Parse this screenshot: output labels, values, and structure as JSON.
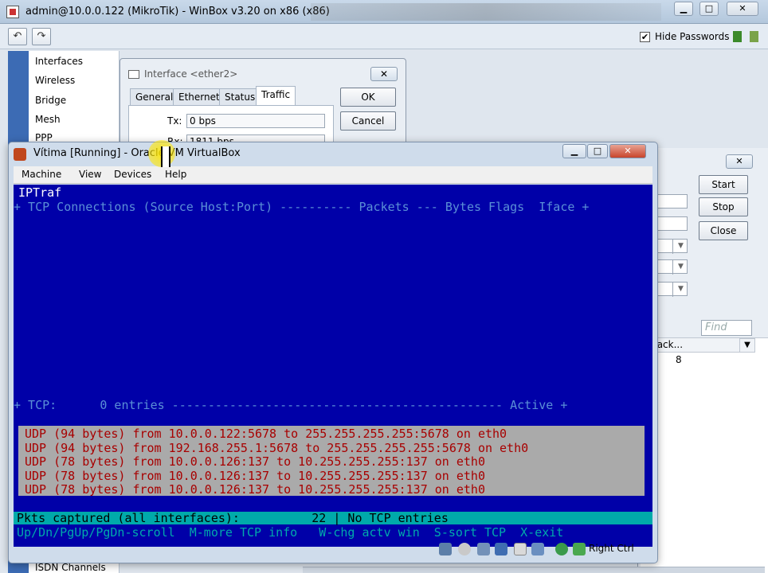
{
  "winbox": {
    "title": "admin@10.0.0.122 (MikroTik) - WinBox v3.20 on x86 (x86)",
    "hide_passwords_label": "Hide Passwords",
    "hide_passwords_checked": true,
    "menu": [
      "Interfaces",
      "Wireless",
      "Bridge",
      "Mesh",
      "PPP"
    ],
    "bottom_menu_item": "ISDN Channels"
  },
  "interface_dialog": {
    "title": "Interface <ether2>",
    "tabs": [
      "General",
      "Ethernet",
      "Status",
      "Traffic"
    ],
    "active_tab": "Traffic",
    "tx_label": "Tx:",
    "tx_value": "0 bps",
    "rx_label": "Rx:",
    "rx_value": "1811 bps",
    "ok_label": "OK",
    "cancel_label": "Cancel"
  },
  "right_dialog": {
    "start_label": "Start",
    "stop_label": "Stop",
    "close_label": "Close",
    "find_placeholder": "Find",
    "column_header": "Pack...",
    "cell_value": "8"
  },
  "vbox": {
    "title": "Vítima [Running] - Oracle VM VirtualBox",
    "menu": [
      "Machine",
      "View",
      "Devices",
      "Help"
    ],
    "host_key": "Right Ctrl"
  },
  "terminal": {
    "app_name": "IPTraf",
    "header": "+ TCP Connections (Source Host:Port) ---------- Packets --- Bytes Flags  Iface +",
    "tcp_footer": "+ TCP:      0 entries ---------------------------------------------- Active +",
    "udp_lines": [
      "UDP (94 bytes) from 10.0.0.122:5678 to 255.255.255.255:5678 on eth0",
      "UDP (94 bytes) from 192.168.255.1:5678 to 255.255.255.255:5678 on eth0",
      "UDP (78 bytes) from 10.0.0.126:137 to 10.255.255.255:137 on eth0",
      "UDP (78 bytes) from 10.0.0.126:137 to 10.255.255.255:137 on eth0",
      "UDP (78 bytes) from 10.0.0.126:137 to 10.255.255.255:137 on eth0"
    ],
    "status_line": "Pkts captured (all interfaces):          22 | No TCP entries",
    "keys_line": "Up/Dn/PgUp/PgDn-scroll  M-more TCP info   W-chg actv win  S-sort TCP  X-exit"
  }
}
